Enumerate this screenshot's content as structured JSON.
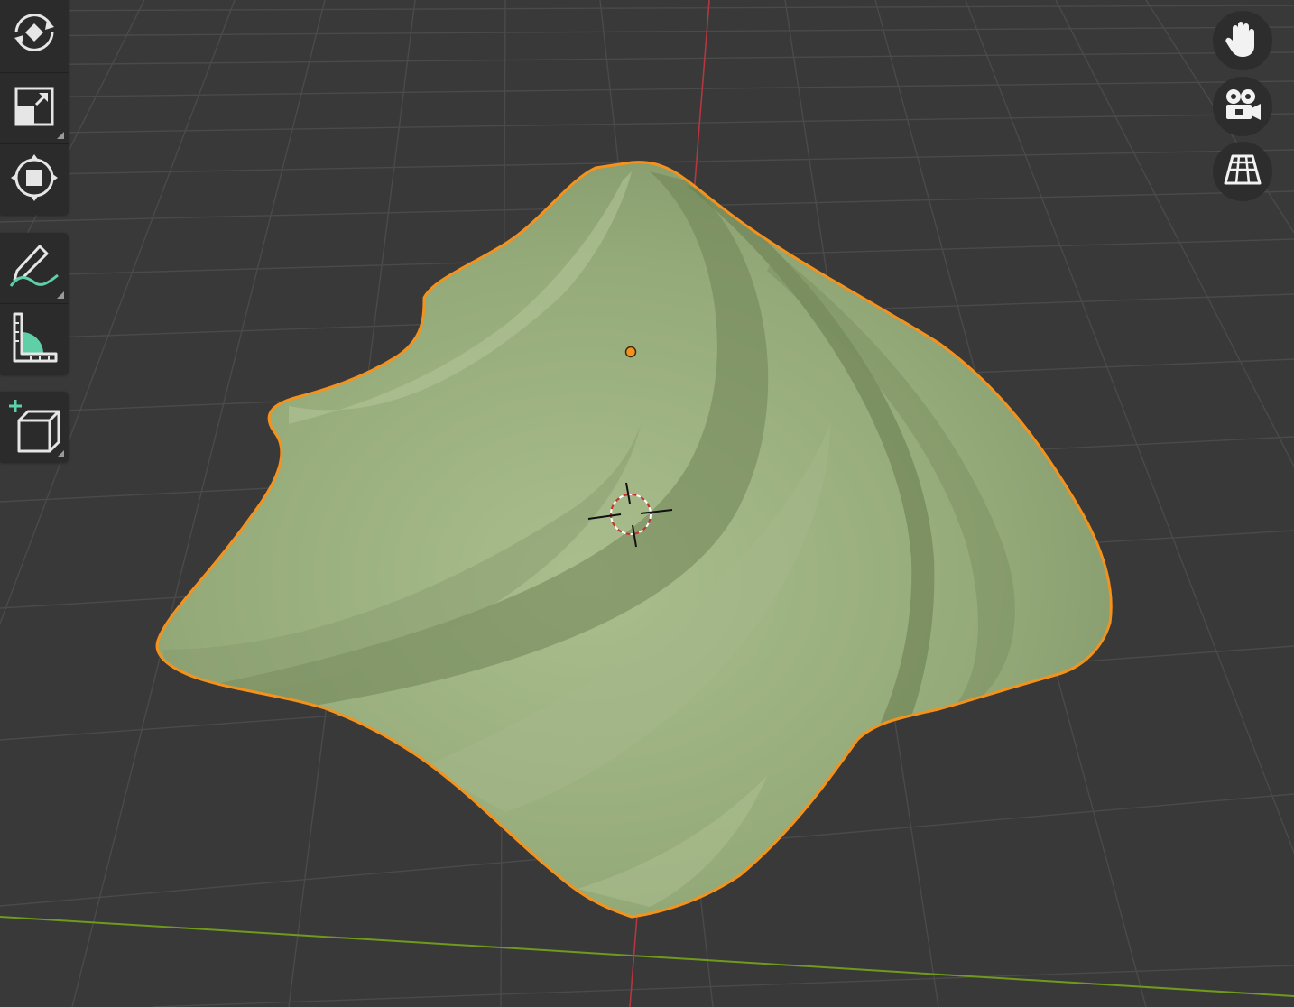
{
  "viewport": {
    "background": "#393939",
    "grid_color": "#4a4a4a",
    "x_axis_color": "#b5363f",
    "y_axis_color": "#6f9a1c",
    "object": {
      "fill": "#9aae7e",
      "outline": "#f5921b",
      "origin_color": "#f5921b"
    }
  },
  "toolbar": {
    "tools": [
      {
        "name": "rotate-tool",
        "icon": "rotate-icon",
        "has_submenu": false
      },
      {
        "name": "scale-tool",
        "icon": "scale-icon",
        "has_submenu": true
      },
      {
        "name": "transform-tool",
        "icon": "transform-icon",
        "has_submenu": false
      },
      {
        "name": "annotate-tool",
        "icon": "annotate-pencil-icon",
        "has_submenu": true
      },
      {
        "name": "measure-tool",
        "icon": "measure-ruler-icon",
        "has_submenu": false
      },
      {
        "name": "add-cube-tool",
        "icon": "add-cube-icon",
        "has_submenu": true
      }
    ]
  },
  "navigation": {
    "buttons": [
      {
        "name": "pan-view-button",
        "icon": "hand-icon"
      },
      {
        "name": "camera-view-button",
        "icon": "camera-icon"
      },
      {
        "name": "perspective-toggle-button",
        "icon": "grid-perspective-icon"
      }
    ]
  },
  "accent_color": "#5fcfa8"
}
